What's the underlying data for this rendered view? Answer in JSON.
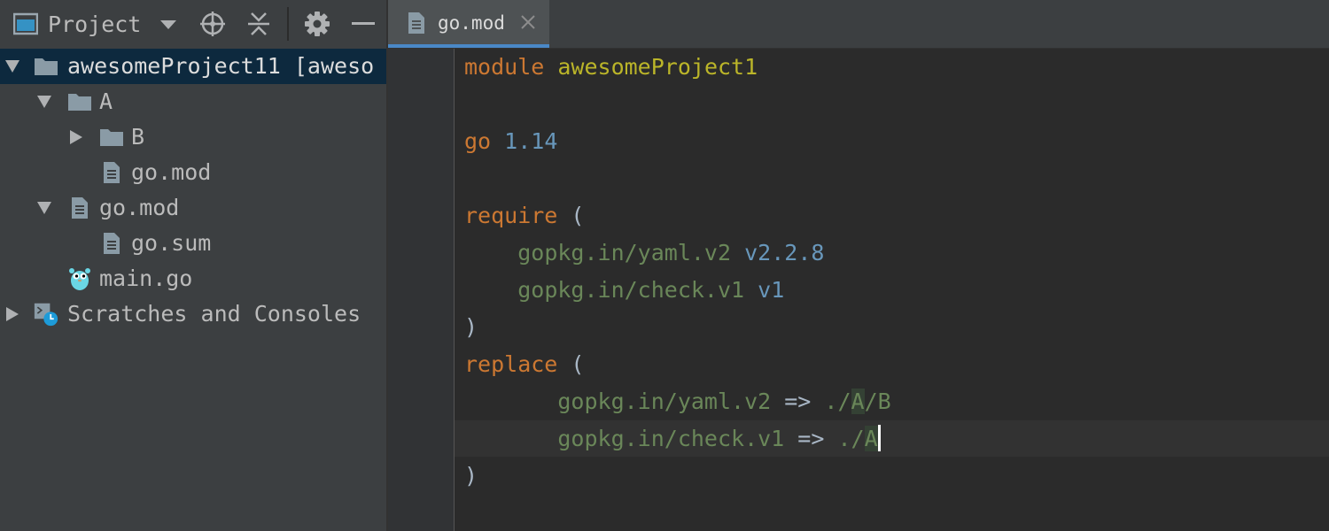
{
  "toolbar": {
    "view_label": "Project",
    "icons": [
      "project-view-icon",
      "chevron-down-icon",
      "locate-icon",
      "collapse-all-icon",
      "gear-icon",
      "minimize-icon"
    ]
  },
  "tree": {
    "items": [
      {
        "label": "awesomeProject11 [aweso",
        "type": "folder",
        "expanded": true,
        "selected": true
      },
      {
        "label": "A",
        "type": "folder",
        "expanded": true
      },
      {
        "label": "B",
        "type": "folder",
        "expanded": false
      },
      {
        "label": "go.mod",
        "type": "file"
      },
      {
        "label": "go.mod",
        "type": "file",
        "expanded": true
      },
      {
        "label": "go.sum",
        "type": "file"
      },
      {
        "label": "main.go",
        "type": "gopher-file"
      },
      {
        "label": "Scratches and Consoles",
        "type": "scratches",
        "expanded": false
      }
    ]
  },
  "editor": {
    "tab": {
      "label": "go.mod",
      "active": true
    },
    "code": {
      "l1": {
        "kw": "module",
        "name": "awesomeProject1"
      },
      "l3": {
        "kw": "go",
        "version": "1.14"
      },
      "l5": {
        "kw": "require",
        "paren": "("
      },
      "l6": {
        "path": "gopkg.in/yaml.v2",
        "version": "v2.2.8"
      },
      "l7": {
        "path": "gopkg.in/check.v1",
        "version": "v1"
      },
      "l8": {
        "paren": ")"
      },
      "l9": {
        "kw": "replace",
        "paren": "("
      },
      "l10": {
        "path": "gopkg.in/yaml.v2",
        "arrow": "=>",
        "target_a": "./",
        "target_b": "A",
        "target_c": "/B"
      },
      "l11": {
        "path": "gopkg.in/check.v1",
        "arrow": "=>",
        "target_a": "./",
        "target_b": "A"
      },
      "l12": {
        "paren": ")"
      }
    }
  },
  "colors": {
    "keyword": "#cc7832",
    "module_name": "#bbb529",
    "number": "#6897bb",
    "path": "#6a8759",
    "selection": "#0d293e",
    "tab_accent": "#4a88c7"
  }
}
